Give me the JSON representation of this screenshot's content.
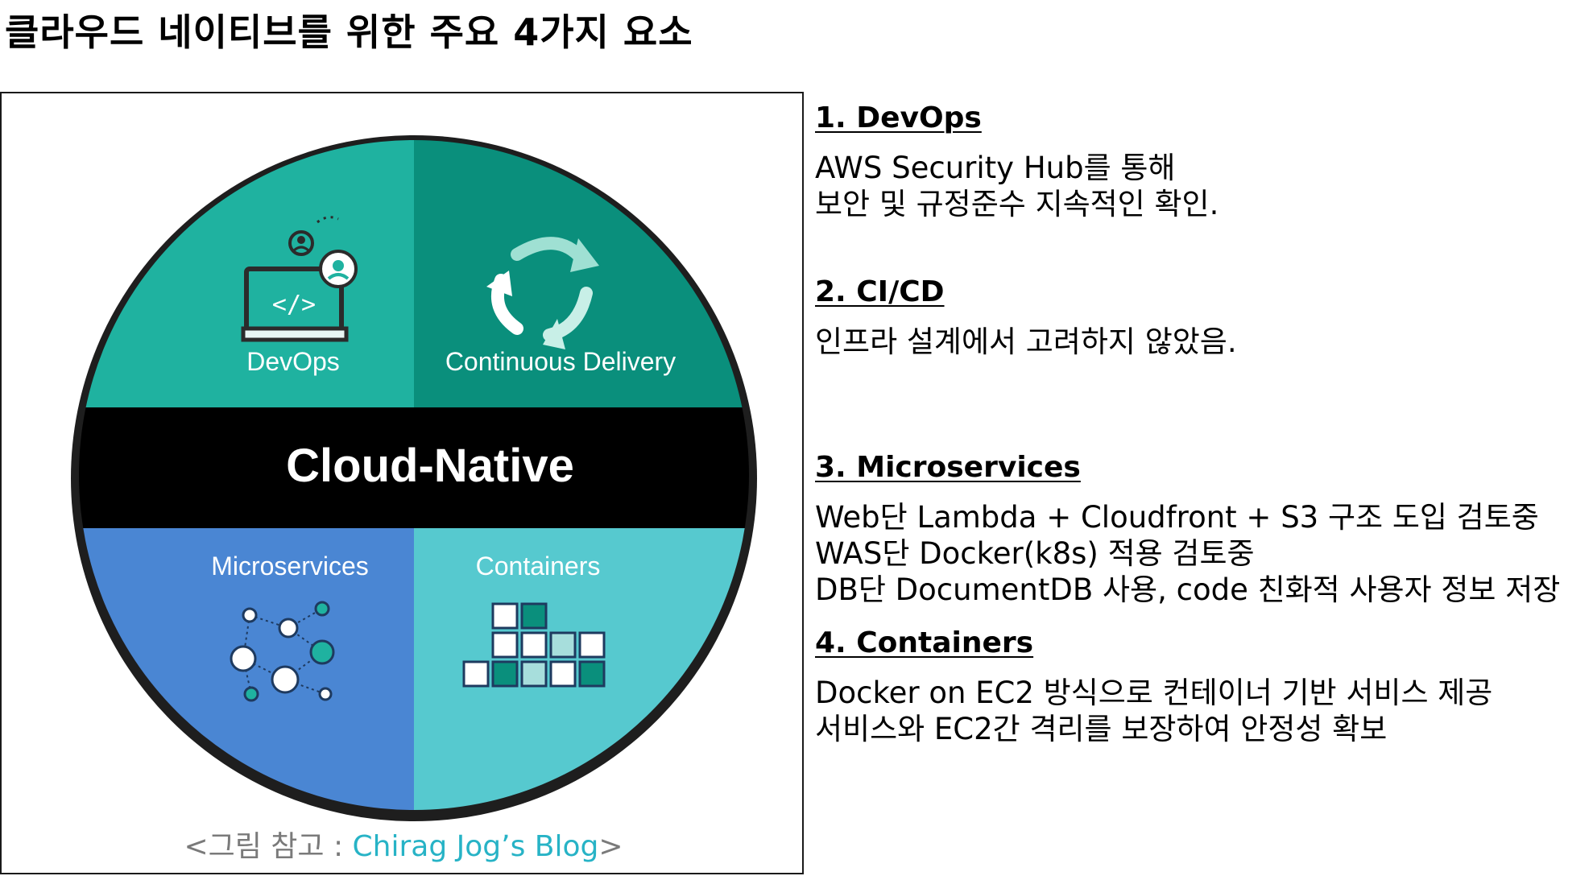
{
  "title": "클라우드 네이티브를 위한 주요 4가지 요소",
  "figure": {
    "center_label": "Cloud-Native",
    "quadrants": {
      "top_left": {
        "label": "DevOps",
        "color": "#1fb2a0",
        "icon": "laptop-code-people-icon"
      },
      "top_right": {
        "label": "Continuous Delivery",
        "color": "#0a8f7c",
        "icon": "cycle-arrows-icon"
      },
      "bottom_left": {
        "label": "Microservices",
        "color": "#4a86d3",
        "icon": "network-nodes-icon"
      },
      "bottom_right": {
        "label": "Containers",
        "color": "#56c9cf",
        "icon": "container-blocks-icon"
      }
    },
    "band_color": "#000000",
    "caption_prefix": "<그림 참고 : ",
    "caption_link": "Chirag Jog’s Blog",
    "caption_suffix": ">"
  },
  "sections": [
    {
      "heading": "1. DevOps",
      "lines": [
        "AWS Security Hub를 통해",
        "보안 및 규정준수 지속적인 확인."
      ]
    },
    {
      "heading": "2. CI/CD",
      "lines": [
        "인프라 설계에서 고려하지 않았음."
      ]
    },
    {
      "heading": "3. Microservices",
      "lines": [
        "Web단 Lambda + Cloudfront + S3 구조 도입 검토중",
        "WAS단 Docker(k8s) 적용 검토중",
        "DB단 DocumentDB 사용, code 친화적 사용자 정보 저장"
      ]
    },
    {
      "heading": "4. Containers",
      "lines": [
        "Docker on EC2 방식으로 컨테이너 기반 서비스 제공",
        "서비스와 EC2간 격리를 보장하여 안정성 확보"
      ]
    }
  ]
}
